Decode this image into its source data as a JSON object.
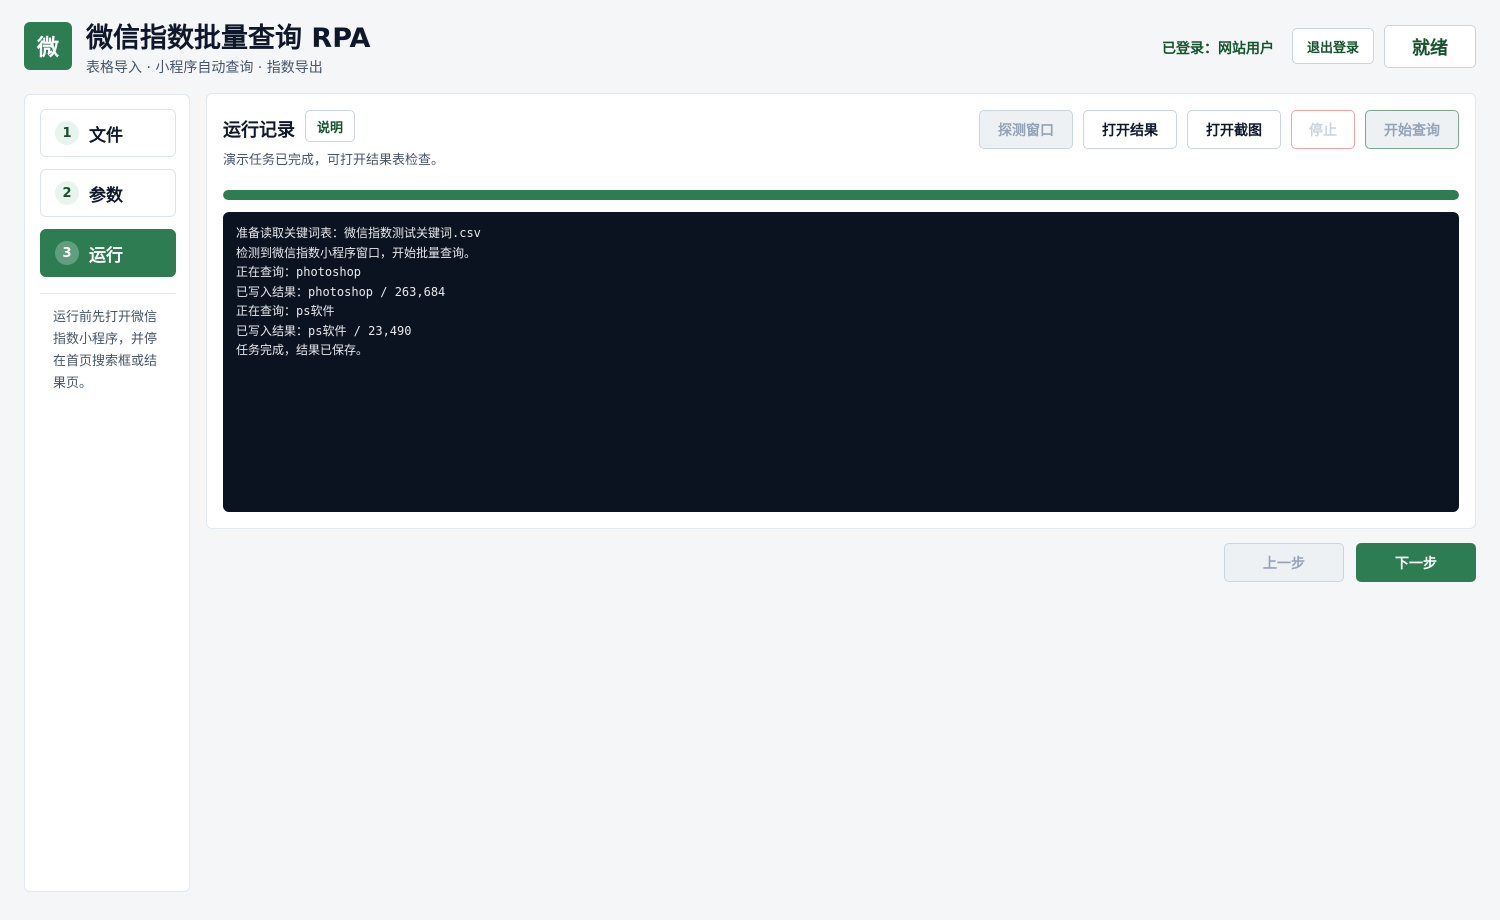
{
  "header": {
    "logo_char": "微",
    "title": "微信指数批量查询 RPA",
    "subtitle": "表格导入 · 小程序自动查询 · 指数导出",
    "login_status": "已登录：网站用户",
    "logout_label": "退出登录",
    "status_label": "就绪"
  },
  "sidebar": {
    "steps": [
      {
        "num": "1",
        "label": "文件"
      },
      {
        "num": "2",
        "label": "参数"
      },
      {
        "num": "3",
        "label": "运行"
      }
    ],
    "active_step": "3",
    "hint": "运行前先打开微信指数小程序，并停在首页搜索框或结果页。"
  },
  "panel": {
    "title": "运行记录",
    "help_label": "说明",
    "description": "演示任务已完成，可打开结果表检查。",
    "toolbar": {
      "detect_window": "探测窗口",
      "open_result": "打开结果",
      "open_screenshot": "打开截图",
      "stop": "停止",
      "start_query": "开始查询"
    },
    "progress": 1.0,
    "log": [
      "准备读取关键词表：微信指数测试关键词.csv",
      "检测到微信指数小程序窗口，开始批量查询。",
      "正在查询：photoshop",
      "已写入结果：photoshop / 263,684",
      "正在查询：ps软件",
      "已写入结果：ps软件 / 23,490",
      "任务完成，结果已保存。"
    ]
  },
  "nav": {
    "prev_label": "上一步",
    "next_label": "下一步"
  },
  "colors": {
    "accent": "#2e7d52",
    "log_bg": "#0b1220"
  }
}
